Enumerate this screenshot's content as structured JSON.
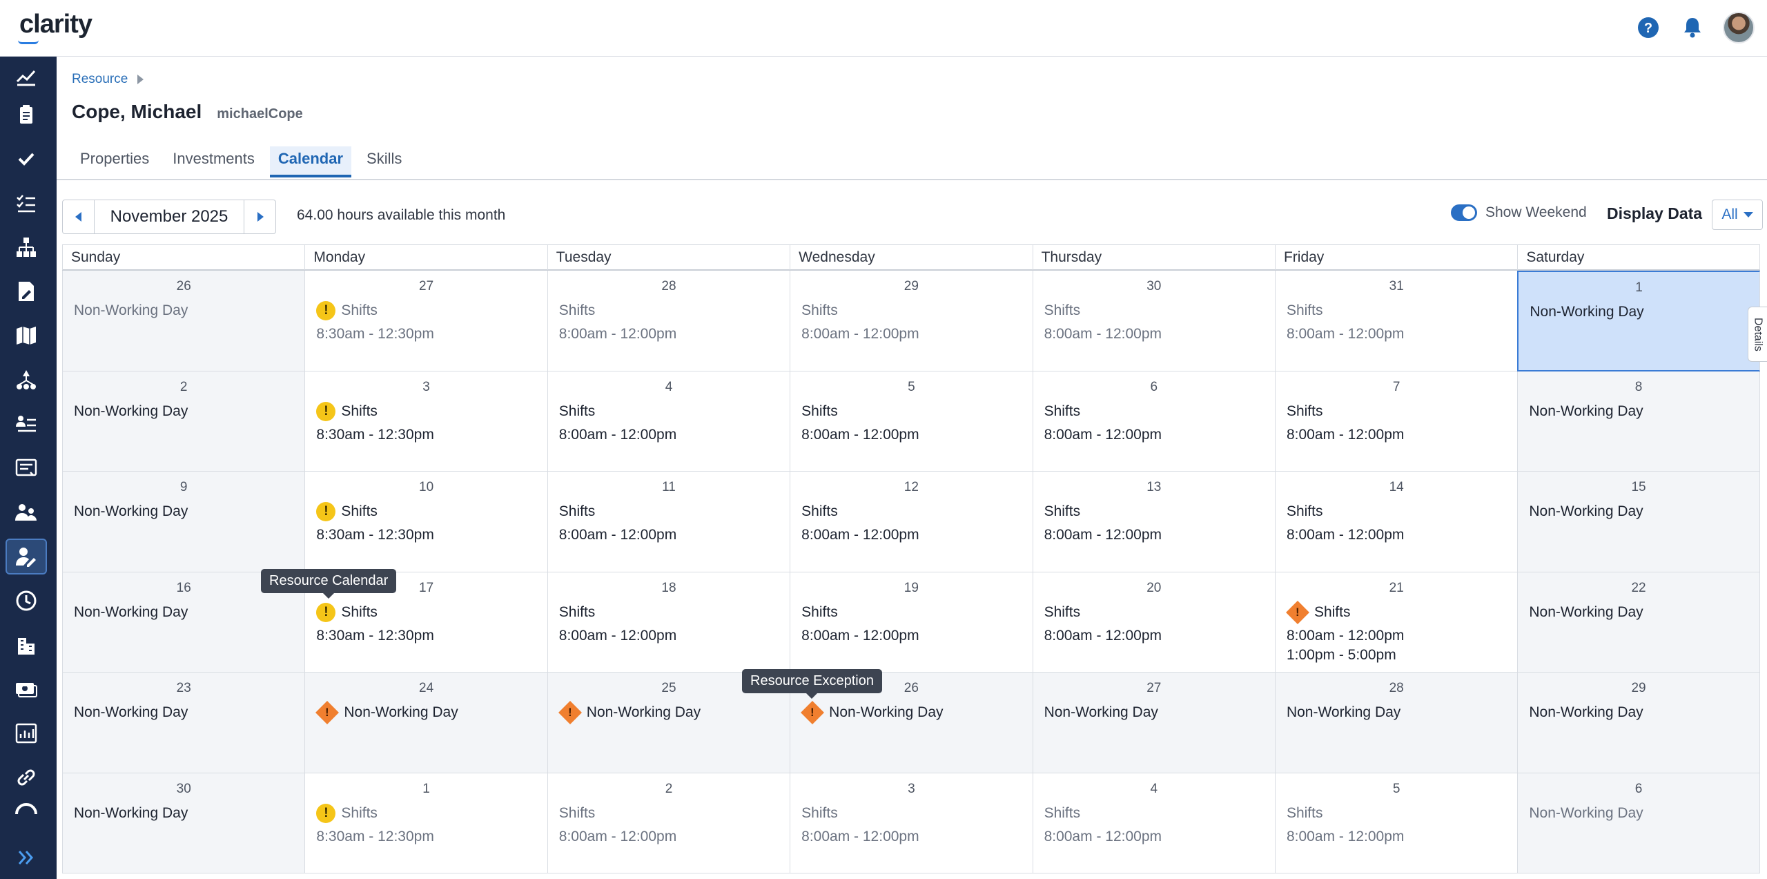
{
  "app": {
    "logo_text": "clarity",
    "accent_color": "#1f66b3",
    "sidebar_color": "#1a2a4a"
  },
  "header_icons": [
    "help-icon",
    "bell-icon",
    "avatar"
  ],
  "sidebar": {
    "items": [
      "trend-icon",
      "clipboard-icon",
      "check-icon",
      "checklist-icon",
      "hierarchy-icon",
      "document-edit-icon",
      "map-icon",
      "org-chart-icon",
      "people-sliders-icon",
      "report-list-icon",
      "team-icon",
      "resource-edit-icon",
      "clock-icon",
      "building-icon",
      "money-icon",
      "chart-icon",
      "link-icon",
      "gauge-icon"
    ],
    "active": "resource-edit-icon"
  },
  "breadcrumb": {
    "label": "Resource"
  },
  "page": {
    "title": "Cope, Michael",
    "subtitle": "michaelCope"
  },
  "tabs": [
    {
      "label": "Properties"
    },
    {
      "label": "Investments"
    },
    {
      "label": "Calendar",
      "active": true
    },
    {
      "label": "Skills"
    }
  ],
  "toolbar": {
    "month": "November 2025",
    "hours_text": "64.00 hours available this month",
    "show_weekend_label": "Show Weekend",
    "show_weekend_on": true,
    "display_data_label": "Display Data",
    "display_data_value": "All"
  },
  "calendar": {
    "weekdays": [
      "Sunday",
      "Monday",
      "Tuesday",
      "Wednesday",
      "Thursday",
      "Friday",
      "Saturday"
    ],
    "weeks": [
      [
        {
          "day": "26",
          "lines": [
            "Non-Working Day"
          ],
          "nonwork": true,
          "muted": true
        },
        {
          "day": "27",
          "label": "Shifts",
          "icon": "yellow",
          "lines": [
            "8:30am - 12:30pm"
          ],
          "muted": true
        },
        {
          "day": "28",
          "label": "Shifts",
          "lines": [
            "8:00am - 12:00pm"
          ],
          "muted": true
        },
        {
          "day": "29",
          "label": "Shifts",
          "lines": [
            "8:00am - 12:00pm"
          ],
          "muted": true
        },
        {
          "day": "30",
          "label": "Shifts",
          "lines": [
            "8:00am - 12:00pm"
          ],
          "muted": true
        },
        {
          "day": "31",
          "label": "Shifts",
          "lines": [
            "8:00am - 12:00pm"
          ],
          "muted": true
        },
        {
          "day": "1",
          "lines": [
            "Non-Working Day"
          ],
          "nonwork": true,
          "selected": true
        }
      ],
      [
        {
          "day": "2",
          "lines": [
            "Non-Working Day"
          ],
          "nonwork": true
        },
        {
          "day": "3",
          "label": "Shifts",
          "icon": "yellow",
          "lines": [
            "8:30am - 12:30pm"
          ]
        },
        {
          "day": "4",
          "label": "Shifts",
          "lines": [
            "8:00am - 12:00pm"
          ]
        },
        {
          "day": "5",
          "label": "Shifts",
          "lines": [
            "8:00am - 12:00pm"
          ]
        },
        {
          "day": "6",
          "label": "Shifts",
          "lines": [
            "8:00am - 12:00pm"
          ]
        },
        {
          "day": "7",
          "label": "Shifts",
          "lines": [
            "8:00am - 12:00pm"
          ]
        },
        {
          "day": "8",
          "lines": [
            "Non-Working Day"
          ],
          "nonwork": true
        }
      ],
      [
        {
          "day": "9",
          "lines": [
            "Non-Working Day"
          ],
          "nonwork": true
        },
        {
          "day": "10",
          "label": "Shifts",
          "icon": "yellow",
          "lines": [
            "8:30am - 12:30pm"
          ]
        },
        {
          "day": "11",
          "label": "Shifts",
          "lines": [
            "8:00am - 12:00pm"
          ]
        },
        {
          "day": "12",
          "label": "Shifts",
          "lines": [
            "8:00am - 12:00pm"
          ]
        },
        {
          "day": "13",
          "label": "Shifts",
          "lines": [
            "8:00am - 12:00pm"
          ]
        },
        {
          "day": "14",
          "label": "Shifts",
          "lines": [
            "8:00am - 12:00pm"
          ]
        },
        {
          "day": "15",
          "lines": [
            "Non-Working Day"
          ],
          "nonwork": true
        }
      ],
      [
        {
          "day": "16",
          "lines": [
            "Non-Working Day"
          ],
          "nonwork": true
        },
        {
          "day": "17",
          "label": "Shifts",
          "icon": "yellow",
          "lines": [
            "8:30am - 12:30pm"
          ]
        },
        {
          "day": "18",
          "label": "Shifts",
          "lines": [
            "8:00am - 12:00pm"
          ]
        },
        {
          "day": "19",
          "label": "Shifts",
          "lines": [
            "8:00am - 12:00pm"
          ]
        },
        {
          "day": "20",
          "label": "Shifts",
          "lines": [
            "8:00am - 12:00pm"
          ]
        },
        {
          "day": "21",
          "label": "Shifts",
          "icon": "orange",
          "lines": [
            "8:00am - 12:00pm",
            "1:00pm - 5:00pm"
          ]
        },
        {
          "day": "22",
          "lines": [
            "Non-Working Day"
          ],
          "nonwork": true
        }
      ],
      [
        {
          "day": "23",
          "lines": [
            "Non-Working Day"
          ],
          "nonwork": true
        },
        {
          "day": "24",
          "label": "Non-Working Day",
          "icon": "orange",
          "lines": [],
          "nonwork": true
        },
        {
          "day": "25",
          "label": "Non-Working Day",
          "icon": "orange",
          "lines": [],
          "nonwork": true
        },
        {
          "day": "26",
          "label": "Non-Working Day",
          "icon": "orange",
          "lines": [],
          "nonwork": true
        },
        {
          "day": "27",
          "lines": [
            "Non-Working Day"
          ],
          "nonwork": true
        },
        {
          "day": "28",
          "lines": [
            "Non-Working Day"
          ],
          "nonwork": true
        },
        {
          "day": "29",
          "lines": [
            "Non-Working Day"
          ],
          "nonwork": true
        }
      ],
      [
        {
          "day": "30",
          "lines": [
            "Non-Working Day"
          ],
          "nonwork": true
        },
        {
          "day": "1",
          "label": "Shifts",
          "icon": "yellow",
          "lines": [
            "8:30am - 12:30pm"
          ],
          "muted": true
        },
        {
          "day": "2",
          "label": "Shifts",
          "lines": [
            "8:00am - 12:00pm"
          ],
          "muted": true
        },
        {
          "day": "3",
          "label": "Shifts",
          "lines": [
            "8:00am - 12:00pm"
          ],
          "muted": true
        },
        {
          "day": "4",
          "label": "Shifts",
          "lines": [
            "8:00am - 12:00pm"
          ],
          "muted": true
        },
        {
          "day": "5",
          "label": "Shifts",
          "lines": [
            "8:00am - 12:00pm"
          ],
          "muted": true
        },
        {
          "day": "6",
          "lines": [
            "Non-Working Day"
          ],
          "nonwork": true,
          "muted": true
        }
      ]
    ]
  },
  "tooltips": {
    "resource_calendar": "Resource Calendar",
    "resource_exception": "Resource Exception"
  },
  "details_tab": "Details"
}
